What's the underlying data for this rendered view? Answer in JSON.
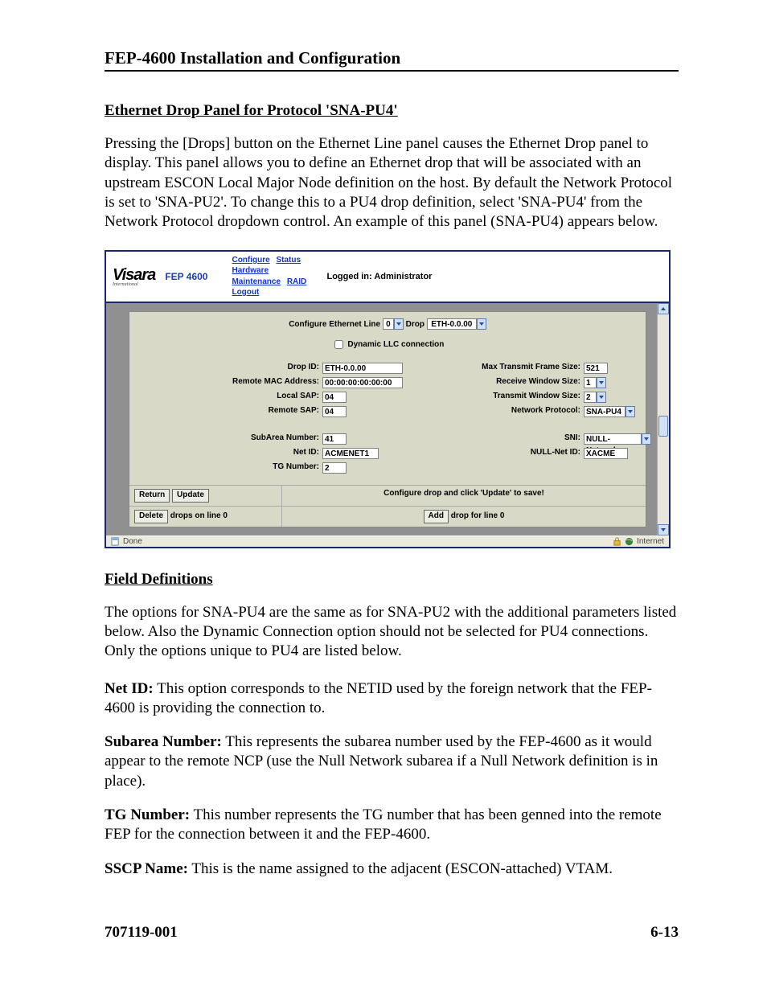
{
  "doc": {
    "title": "FEP-4600 Installation and Configuration",
    "section_heading": "Ethernet Drop Panel for Protocol 'SNA-PU4'",
    "intro": "Pressing the [Drops] button on the Ethernet Line panel causes the Ethernet Drop panel to display. This panel allows you to define an Ethernet drop that will be associated with an upstream ESCON Local Major Node definition on the host. By default the Network Protocol is set to 'SNA-PU2'. To change this to a PU4 drop definition, select 'SNA-PU4' from the Network Protocol dropdown control. An example of this panel (SNA-PU4) appears below.",
    "field_def_heading": "Field Definitions",
    "field_def_intro": "The options for SNA-PU4 are the same as for SNA-PU2 with the additional parameters listed below. Also the Dynamic Connection option should not be selected for PU4 connections. Only the options unique to PU4 are listed below.",
    "defs": {
      "netid_term": "Net ID:",
      "netid_body": "  This option corresponds to the NETID used by the foreign network that the FEP-4600 is providing the connection to.",
      "subarea_term": "Subarea Number:",
      "subarea_body": "  This represents the subarea number used by the FEP-4600 as it would appear to the remote NCP (use the Null Network subarea if a Null Network definition is in place).",
      "tg_term": "TG Number:",
      "tg_body": "  This number represents the TG number that has been genned into the remote FEP for the connection between it and the FEP-4600.",
      "sscp_term": "SSCP Name:",
      "sscp_body": "  This is the name assigned to the adjacent (ESCON-attached) VTAM."
    },
    "footer_left": "707119-001",
    "footer_right": "6-13"
  },
  "shot": {
    "logo_text": "Visara",
    "logo_sub": "International",
    "model": "FEP 4600",
    "nav": {
      "configure": "Configure",
      "status": "Status",
      "hardware": "Hardware",
      "maintenance": "Maintenance",
      "raid": "RAID",
      "logout": "Logout"
    },
    "logged_in": "Logged in: Administrator",
    "title_row": {
      "label1": "Configure Ethernet Line",
      "line_sel": "0",
      "label2": "Drop",
      "drop_sel": "ETH-0.0.00"
    },
    "dyn_label": "Dynamic LLC connection",
    "fields": {
      "drop_id_lbl": "Drop ID:",
      "drop_id_val": "ETH-0.0.00",
      "max_tx_lbl": "Max Transmit Frame Size:",
      "max_tx_val": "521",
      "rmac_lbl": "Remote MAC Address:",
      "rmac_val": "00:00:00:00:00:00",
      "rxwin_lbl": "Receive Window Size:",
      "rxwin_val": "1",
      "lsap_lbl": "Local SAP:",
      "lsap_val": "04",
      "txwin_lbl": "Transmit Window Size:",
      "txwin_val": "2",
      "rsap_lbl": "Remote SAP:",
      "rsap_val": "04",
      "nproto_lbl": "Network Protocol:",
      "nproto_val": "SNA-PU4",
      "subarea_lbl": "SubArea Number:",
      "subarea_val": "41",
      "sni_lbl": "SNI:",
      "sni_val": "NULL-Network",
      "netid_lbl": "Net ID:",
      "netid_val": "ACMENET1",
      "nullnet_lbl": "NULL-Net ID:",
      "nullnet_val": "XACME",
      "tg_lbl": "TG Number:",
      "tg_val": "2"
    },
    "buttons": {
      "return": "Return",
      "update": "Update",
      "update_hint": "Configure drop and click 'Update' to save!",
      "delete": "Delete",
      "delete_suffix": " drops on line 0",
      "add": "Add",
      "add_suffix": " drop for line 0"
    },
    "status": {
      "done": "Done",
      "zone": "Internet"
    }
  }
}
